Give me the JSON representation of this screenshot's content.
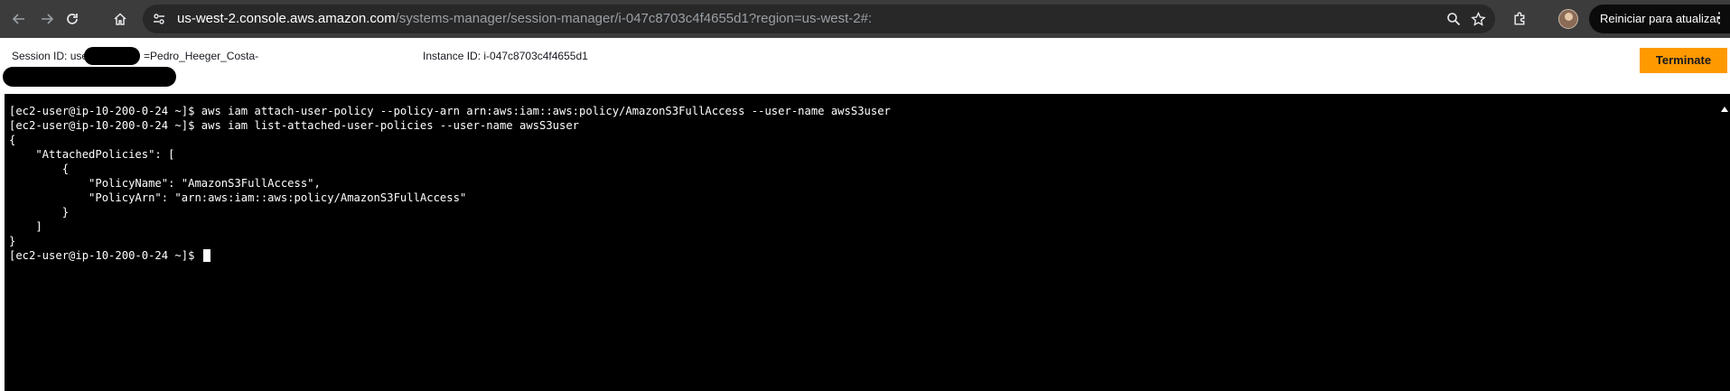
{
  "browser": {
    "url_host": "us-west-2.console.aws.amazon.com",
    "url_path": "/systems-manager/session-manager/i-047c8703c4f4655d1?region=us-west-2#:",
    "update_button_label": "Reiniciar para atualizar",
    "icons": {
      "back": "back-arrow-icon",
      "forward": "forward-arrow-icon",
      "reload": "reload-icon",
      "home": "home-icon",
      "site_info": "site-info-icon",
      "zoom": "zoom-icon",
      "bookmark": "star-icon",
      "extensions": "extensions-icon",
      "menu": "kebab-menu-icon"
    }
  },
  "session": {
    "session_id_prefix": "Session ID: use",
    "session_id_suffix": "=Pedro_Heeger_Costa-",
    "instance_id_text": "Instance ID: i-047c8703c4f4655d1",
    "terminate_label": "Terminate",
    "terminate_color": "#ff9900"
  },
  "terminal": {
    "lines": [
      "[ec2-user@ip-10-200-0-24 ~]$ aws iam attach-user-policy --policy-arn arn:aws:iam::aws:policy/AmazonS3FullAccess --user-name awsS3user",
      "[ec2-user@ip-10-200-0-24 ~]$ aws iam list-attached-user-policies --user-name awsS3user",
      "{",
      "    \"AttachedPolicies\": [",
      "        {",
      "            \"PolicyName\": \"AmazonS3FullAccess\",",
      "            \"PolicyArn\": \"arn:aws:iam::aws:policy/AmazonS3FullAccess\"",
      "        }",
      "    ]",
      "}"
    ],
    "prompt": "[ec2-user@ip-10-200-0-24 ~]$ "
  }
}
